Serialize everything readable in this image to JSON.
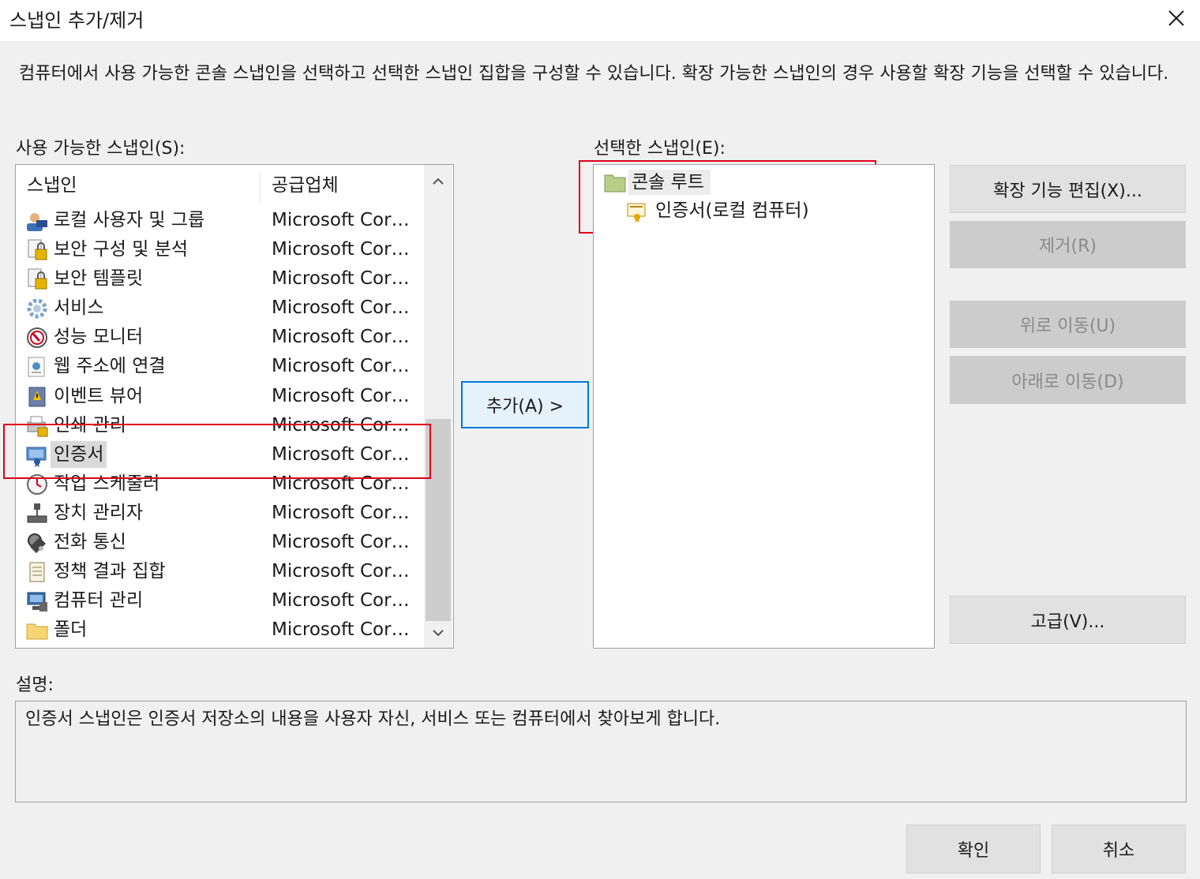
{
  "window": {
    "title": "스냅인 추가/제거",
    "close_icon": "close-icon"
  },
  "intro_text": "컴퓨터에서 사용 가능한 콘솔 스냅인을 선택하고 선택한 스냅인 집합을 구성할 수 있습니다. 확장 가능한 스냅인의 경우 사용할 확장 기능을 선택할 수 있습니다.",
  "available": {
    "label": "사용 가능한 스냅인(S):",
    "columns": {
      "name": "스냅인",
      "vendor": "공급업체"
    },
    "items": [
      {
        "name": "로컬 사용자 및 그룹",
        "vendor": "Microsoft Corpo...",
        "icon": "users-icon"
      },
      {
        "name": "보안 구성 및 분석",
        "vendor": "Microsoft Corpo...",
        "icon": "security-config-icon"
      },
      {
        "name": "보안 템플릿",
        "vendor": "Microsoft Corpo...",
        "icon": "security-template-icon"
      },
      {
        "name": "서비스",
        "vendor": "Microsoft Corpo...",
        "icon": "gear-icon"
      },
      {
        "name": "성능 모니터",
        "vendor": "Microsoft Corpo...",
        "icon": "gauge-icon"
      },
      {
        "name": "웹 주소에 연결",
        "vendor": "Microsoft Corpo...",
        "icon": "web-link-icon"
      },
      {
        "name": "이벤트 뷰어",
        "vendor": "Microsoft Corpo...",
        "icon": "event-viewer-icon"
      },
      {
        "name": "인쇄 관리",
        "vendor": "Microsoft Corpo...",
        "icon": "printer-icon"
      },
      {
        "name": "인증서",
        "vendor": "Microsoft Corpo...",
        "icon": "certificate-icon"
      },
      {
        "name": "작업 스케줄러",
        "vendor": "Microsoft Corpo...",
        "icon": "clock-icon"
      },
      {
        "name": "장치 관리자",
        "vendor": "Microsoft Corpo...",
        "icon": "device-manager-icon"
      },
      {
        "name": "전화 통신",
        "vendor": "Microsoft Corpo...",
        "icon": "telephony-icon"
      },
      {
        "name": "정책 결과 집합",
        "vendor": "Microsoft Corpo...",
        "icon": "policy-icon"
      },
      {
        "name": "컴퓨터 관리",
        "vendor": "Microsoft Corpo...",
        "icon": "computer-management-icon"
      },
      {
        "name": "폴더",
        "vendor": "Microsoft Corpo...",
        "icon": "folder-icon"
      }
    ],
    "selected_index": 8
  },
  "add_button": "추가(A) >",
  "selected": {
    "label": "선택한 스냅인(E):",
    "root": "콘솔 루트",
    "child": "인증서(로컬 컴퓨터)"
  },
  "buttons": {
    "edit_extensions": "확장 기능 편집(X)...",
    "remove": "제거(R)",
    "move_up": "위로 이동(U)",
    "move_down": "아래로 이동(D)",
    "advanced": "고급(V)...",
    "ok": "확인",
    "cancel": "취소"
  },
  "description": {
    "label": "설명:",
    "text": "인증서 스냅인은 인증서 저장소의 내용을 사용자 자신, 서비스 또는 컴퓨터에서 찾아보게 합니다."
  },
  "colors": {
    "highlight_border": "#e0001b",
    "focus_border": "#0078d7",
    "window_bg": "#f0f0f0"
  }
}
